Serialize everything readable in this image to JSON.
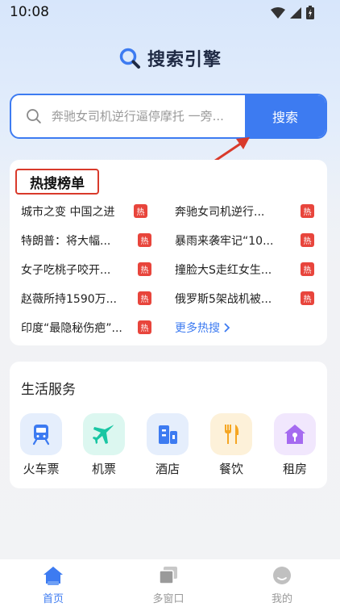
{
  "status_bar": {
    "time": "10:08"
  },
  "app": {
    "title": "搜索引擎"
  },
  "search": {
    "placeholder": "奔驰女司机逆行逼停摩托 一旁...",
    "button_label": "搜索"
  },
  "hot_list": {
    "title": "热搜榜单",
    "badge": "热",
    "items": [
      {
        "text": "城市之变 中国之进"
      },
      {
        "text": "奔驰女司机逆行..."
      },
      {
        "text": "特朗普：将大幅..."
      },
      {
        "text": "暴雨来袭牢记“10..."
      },
      {
        "text": "女子吃桃子咬开..."
      },
      {
        "text": "撞脸大S走红女生..."
      },
      {
        "text": "赵薇所持1590万..."
      },
      {
        "text": "俄罗斯5架战机被..."
      },
      {
        "text": "印度“最隐秘伤疤”..."
      }
    ],
    "more_label": "更多热搜"
  },
  "life_services": {
    "title": "生活服务",
    "items": [
      {
        "label": "火车票",
        "icon": "train-icon",
        "color": "#3d7bf1"
      },
      {
        "label": "机票",
        "icon": "airplane-icon",
        "color": "#19c6a3"
      },
      {
        "label": "酒店",
        "icon": "hotel-icon",
        "color": "#3d7bf1"
      },
      {
        "label": "餐饮",
        "icon": "restaurant-icon",
        "color": "#f5a623"
      },
      {
        "label": "租房",
        "icon": "house-rent-icon",
        "color": "#a56af0"
      }
    ]
  },
  "tabs": [
    {
      "label": "首页",
      "icon": "home-icon",
      "active": true
    },
    {
      "label": "多窗口",
      "icon": "windows-icon",
      "active": false
    },
    {
      "label": "我的",
      "icon": "profile-icon",
      "active": false
    }
  ],
  "colors": {
    "accent": "#3d7bf1",
    "hot_badge": "#e8453c",
    "annotation": "#d93a2b"
  }
}
